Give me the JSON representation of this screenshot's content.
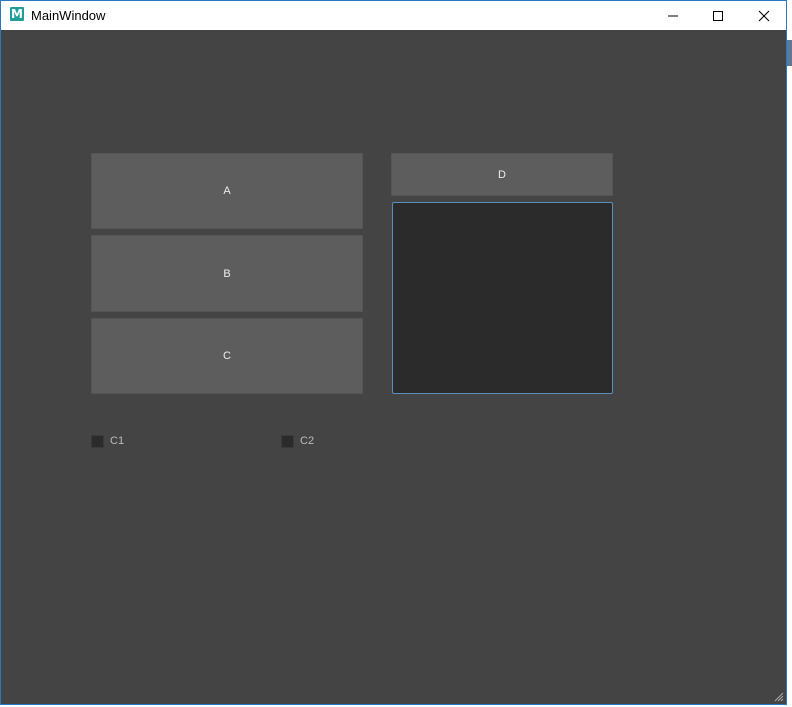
{
  "window": {
    "title": "MainWindow",
    "app_icon_letter": "M",
    "accent_color": "#2b78c2"
  },
  "buttons": {
    "a_label": "A",
    "b_label": "B",
    "c_label": "C",
    "d_label": "D"
  },
  "checkboxes": [
    {
      "label": "C1",
      "checked": false
    },
    {
      "label": "C2",
      "checked": false
    }
  ],
  "colors": {
    "background": "#444444",
    "button": "#5d5d5d",
    "panel": "#2b2b2b",
    "panel_border": "#5b8fb9"
  }
}
